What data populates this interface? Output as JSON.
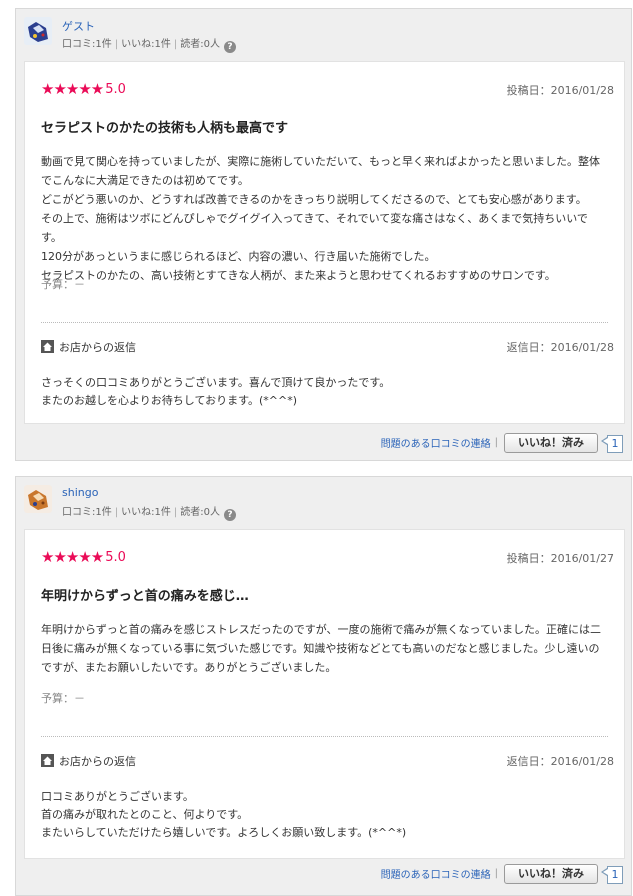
{
  "icons": {
    "help": "question-circle-icon",
    "home": "home-icon",
    "star": "star-icon"
  },
  "colors": {
    "star": "#ea0b57",
    "link": "#2a63b8"
  },
  "reviews": [
    {
      "user": {
        "name": "ゲスト",
        "stat_reviews": "口コミ:1件",
        "stat_likes": "いいね:1件",
        "stat_readers": "読者:0人",
        "help": "?"
      },
      "rating": {
        "value": 5.0,
        "stars": "★★★★★",
        "score": "5.0"
      },
      "posted": "投稿日：2016/01/28",
      "title": "セラピストのかたの技術も人柄も最高です",
      "body": "動画で見て関心を持っていましたが、実際に施術していただいて、もっと早く来ればよかったと思いました。整体でこんなに大満足できたのは初めてです。\nどこがどう悪いのか、どうすれば改善できるのかをきっちり説明してくださるので、とても安心感があります。\nその上で、施術はツボにどんぴしゃでグイグイ入ってきて、それでいて変な痛さはなく、あくまで気持ちいいです。\n120分があっというまに感じられるほど、内容の濃い、行き届いた施術でした。\nセラピストのかたの、高い技術とすてきな人柄が、また来ようと思わせてくれるおすすめのサロンです。",
      "budget": "予算：－",
      "reply": {
        "heading": "お店からの返信",
        "date": "返信日：2016/01/28",
        "body": "さっそくの口コミありがとうございます。喜んで頂けて良かったです。\nまたのお越しを心よりお待ちしております。(*^^*)"
      },
      "footer": {
        "report": "問題のある口コミの連絡",
        "sep": "|",
        "like": "いいね！済み",
        "count": "1"
      }
    },
    {
      "user": {
        "name": "shingo",
        "stat_reviews": "口コミ:1件",
        "stat_likes": "いいね:1件",
        "stat_readers": "読者:0人",
        "help": "?"
      },
      "rating": {
        "value": 5.0,
        "stars": "★★★★★",
        "score": "5.0"
      },
      "posted": "投稿日：2016/01/27",
      "title": "年明けからずっと首の痛みを感じ…",
      "body": "年明けからずっと首の痛みを感じストレスだったのですが、一度の施術で痛みが無くなっていました。正確には二日後に痛みが無くなっている事に気づいた感じです。知識や技術などとても高いのだなと感じました。少し遠いのですが、またお願いしたいです。ありがとうございました。",
      "budget": "予算：－",
      "reply": {
        "heading": "お店からの返信",
        "date": "返信日：2016/01/28",
        "body": "口コミありがとうございます。\n首の痛みが取れたとのこと、何よりです。\nまたいらしていただけたら嬉しいです。よろしくお願い致します。(*^^*)"
      },
      "footer": {
        "report": "問題のある口コミの連絡",
        "sep": "|",
        "like": "いいね！済み",
        "count": "1"
      }
    }
  ]
}
